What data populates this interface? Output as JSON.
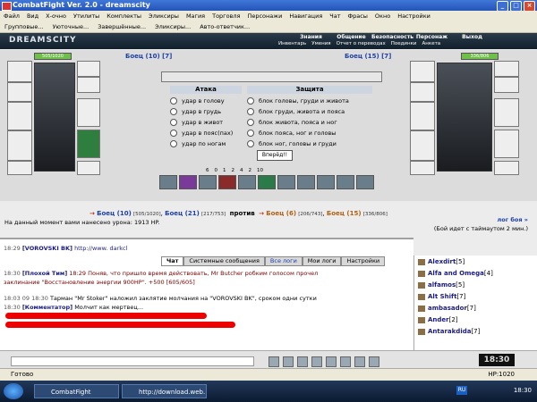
{
  "window": {
    "title": "CombatFight Ver. 2.0 - dreamscity"
  },
  "menubar": [
    "Файл",
    "Вид",
    "Х-очно",
    "Утилиты",
    "Комплекты",
    "Эликсиры",
    "Магия",
    "Торговля",
    "Персонажи",
    "Навигация",
    "Чат",
    "Фрасы",
    "Окно",
    "Настройки"
  ],
  "toolbar": [
    "Групповые...",
    "Уюточные...",
    "Завершённые...",
    "Эликсиры...",
    "Авто-ответчик..."
  ],
  "game": {
    "logo": "DREAMSCITY",
    "toplinks": [
      "Знания",
      "Общение",
      "Безопасность",
      "Персонаж",
      "Выход"
    ],
    "sublinks": [
      "Инвентарь",
      "Умения",
      "Отчет о переводах",
      "Поединки",
      "Анкета"
    ]
  },
  "fighters": {
    "left": {
      "name": "Боец",
      "level": "(10)",
      "rank": "[7]",
      "hp": "505/1020"
    },
    "right": {
      "name": "Боец",
      "level": "(15)",
      "rank": "[7]",
      "hp": "336/806"
    }
  },
  "attack": {
    "header": "Атака",
    "options": [
      "удар в голову",
      "удар в грудь",
      "удар в живот",
      "удар в пояс(пах)",
      "удар по ногам"
    ]
  },
  "defense": {
    "header": "Защита",
    "options": [
      "блок головы, груди и живота",
      "блок груди, живота и пояса",
      "блок живота, пояса и ног",
      "блок пояса, ног и головы",
      "блок ног, головы и груди"
    ]
  },
  "go_button": "Вперёд!!",
  "counters": [
    "6",
    "0",
    "1",
    "2",
    "4",
    "2",
    "10"
  ],
  "vs": {
    "a1": "Боец (10)",
    "a1hp": "[505/1020]",
    "a2": "Боец (21)",
    "a2hp": "[217/753]",
    "word": "против",
    "b1": "Боец (6)",
    "b1hp": "[206/743]",
    "b2": "Боец (15)",
    "b2hp": "[336/806]"
  },
  "damage_msg": "На данный момент вами нанесено урона: 1913 HP.",
  "log_link": "лог боя »",
  "timeout_msg": "(Бой идет с таймаутом 2 мин.)",
  "chat": {
    "tabs": [
      "Чат",
      "Системные сообщения",
      "Все логи",
      "Мои логи",
      "Настройки"
    ],
    "lines": [
      {
        "time": "18:29",
        "nick": "[VOROVSKI BK]",
        "text": "http://www. darkcl"
      },
      {
        "time": "18:30",
        "nick": "[Плохой Тим]",
        "text": "18:29 Поняв, что пришло время действовать, Mr Butcher робким голосом прочел"
      },
      {
        "time": "",
        "nick": "",
        "text": "заклинание \"Восстановление энергии 900HP\". +500 [605/605]"
      },
      {
        "time": "18:03 09 18:30",
        "nick": "",
        "text": "Тарман \"Mr Stoker\" наложил заклятие молчания на \"VOROVSKI BK\", сроком одни сутки"
      },
      {
        "time": "18:30",
        "nick": "[Комментатор]",
        "text": "Молчит как мертвец..."
      }
    ]
  },
  "users": [
    {
      "name": "Alexdirt",
      "lvl": "[5]"
    },
    {
      "name": "Alfa and Omega",
      "lvl": "[4]"
    },
    {
      "name": "alfamos",
      "lvl": "[5]"
    },
    {
      "name": "Alt Shift",
      "lvl": "[7]"
    },
    {
      "name": "ambasador",
      "lvl": "[7]"
    },
    {
      "name": "Ander",
      "lvl": "[2]"
    },
    {
      "name": "Antarakdida",
      "lvl": "[7]"
    }
  ],
  "clock_game": "18:30",
  "status": {
    "ready": "Готово",
    "hp": "HP:1020"
  },
  "taskbar": {
    "task1": "CombatFight",
    "task2": "http://download.web...",
    "lang": "RU",
    "time": "18:30"
  }
}
